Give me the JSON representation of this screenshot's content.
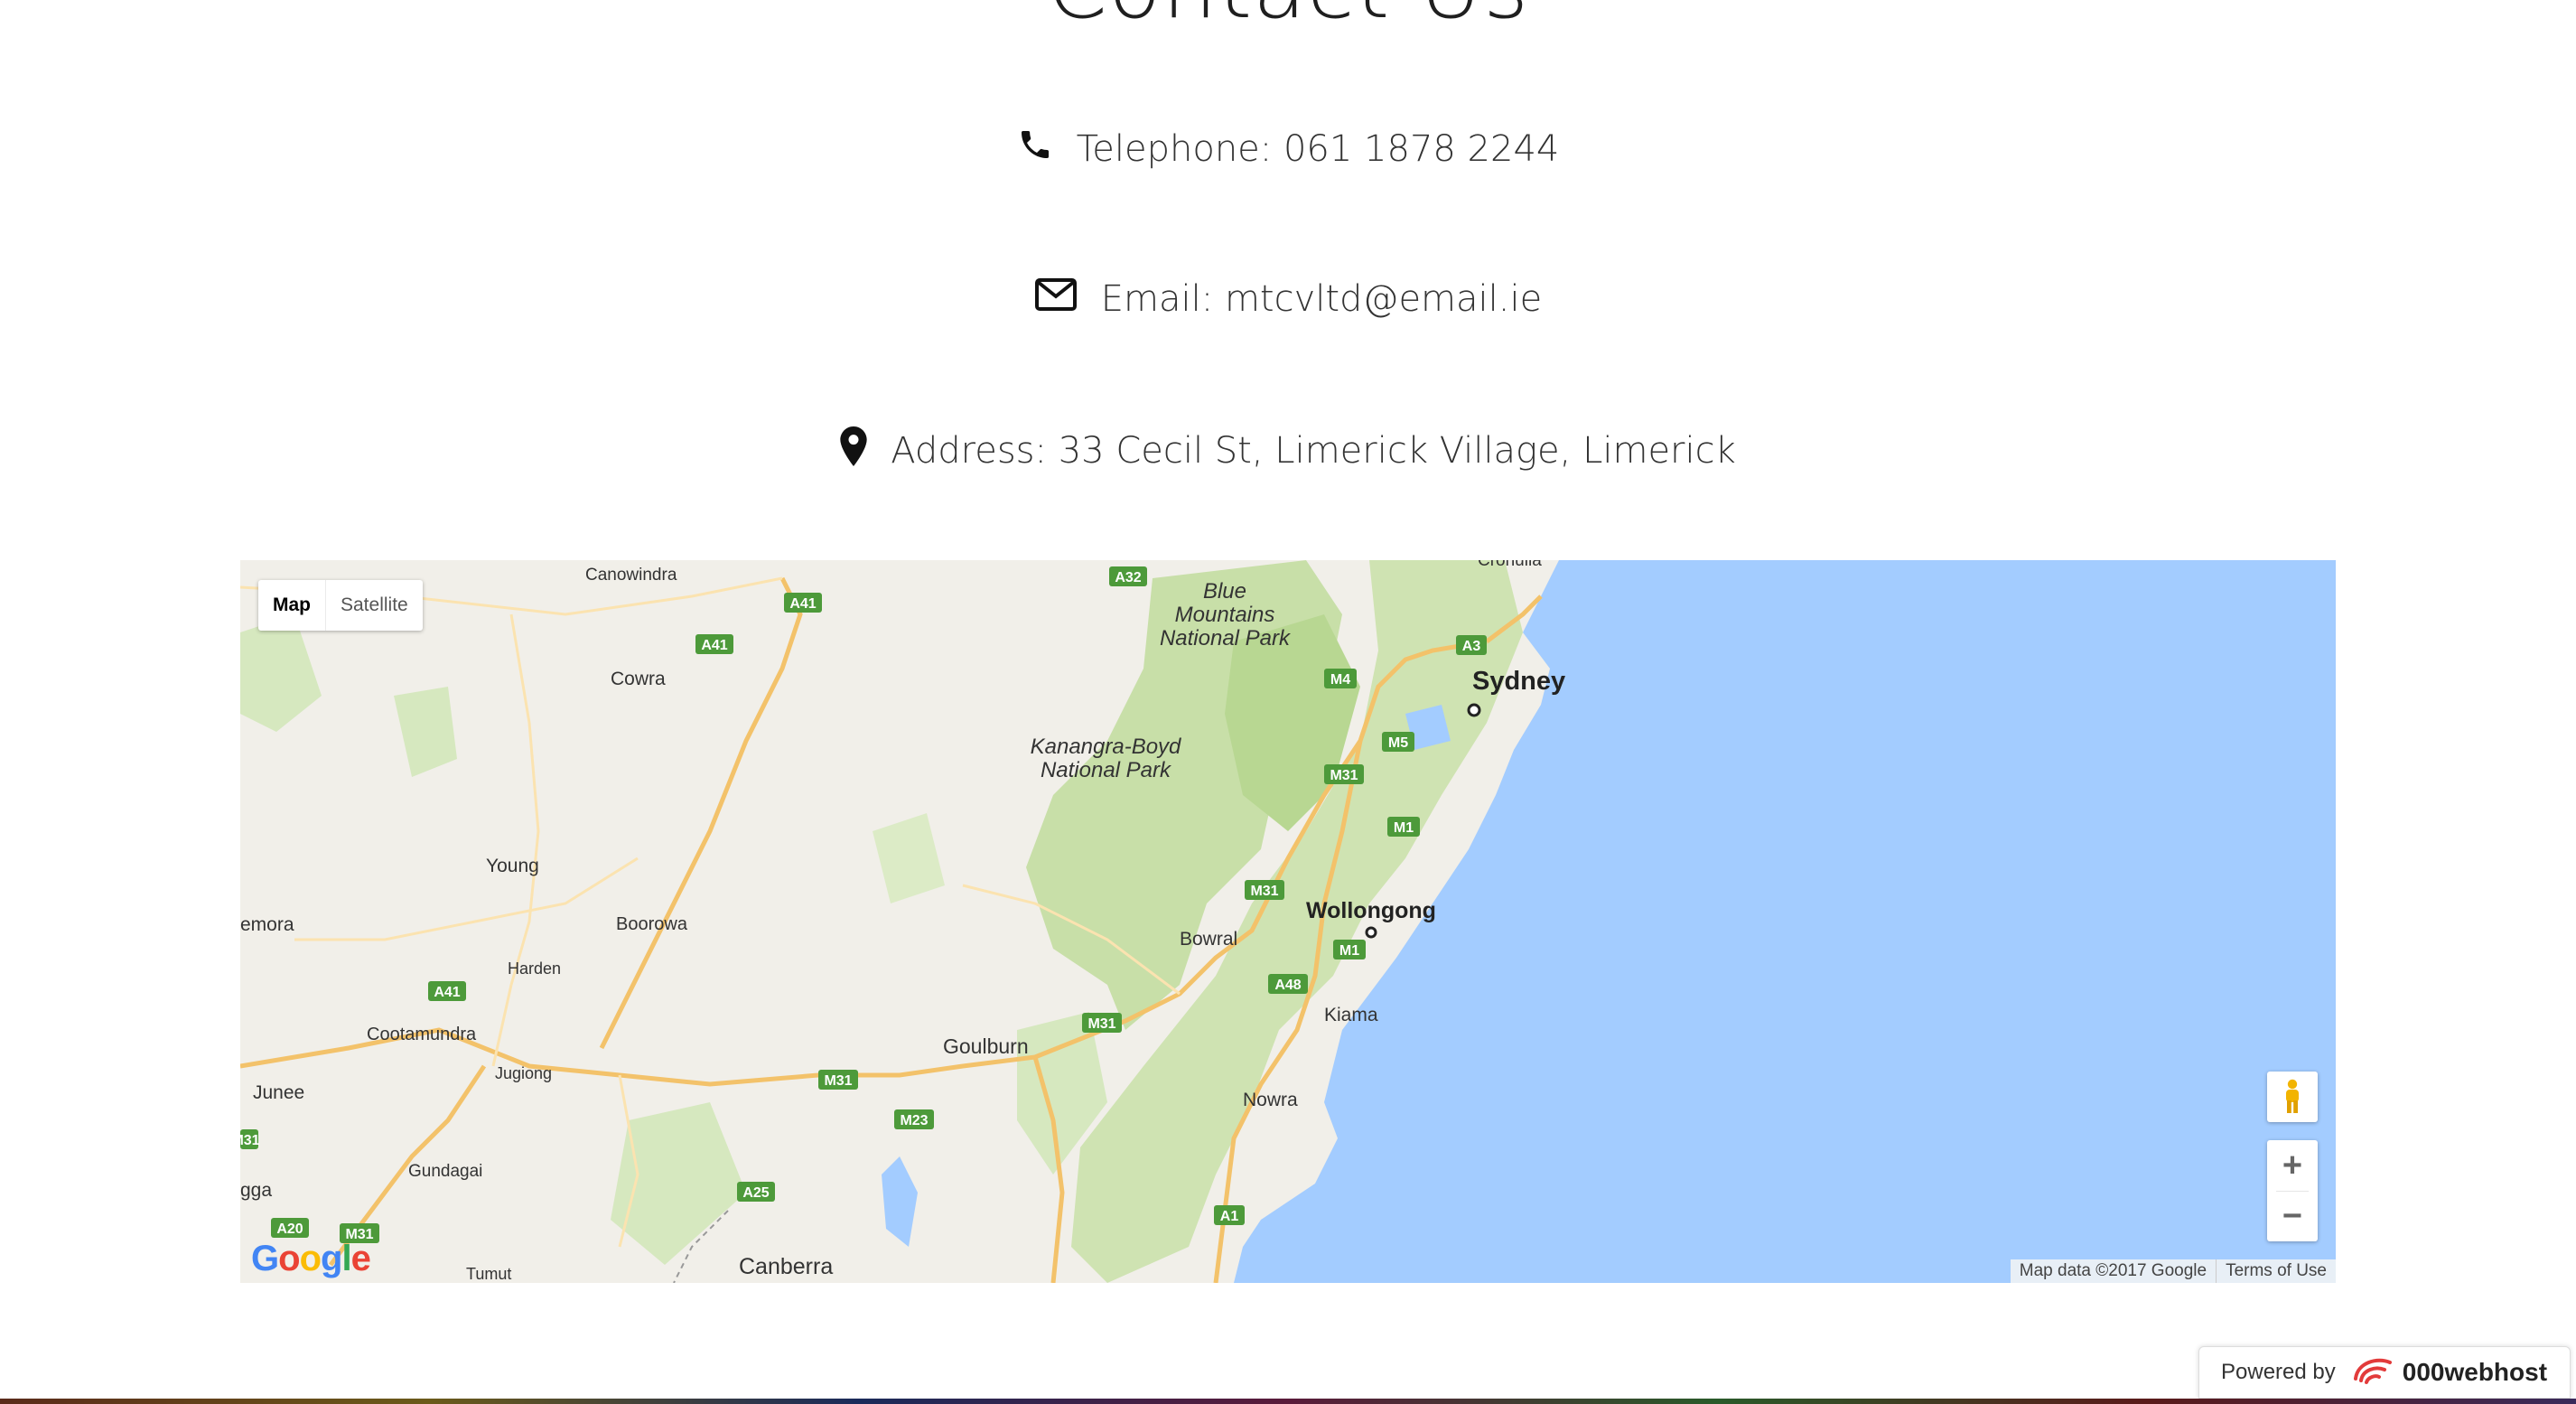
{
  "page": {
    "title": "Contact Us"
  },
  "contact": {
    "telephone": "Telephone: 061 1878 2244",
    "email": "Email: mtcvltd@email.ie",
    "address": "Address: 33 Cecil St, Limerick Village, Limerick"
  },
  "map": {
    "type_control": {
      "map": "Map",
      "satellite": "Satellite"
    },
    "zoom_in": "+",
    "zoom_out": "−",
    "attribution": "Map data ©2017 Google",
    "terms": "Terms of Use",
    "logo": "Google",
    "places": {
      "sydney": "Sydney",
      "wollongong": "Wollongong",
      "bowral": "Bowral",
      "kiama": "Kiama",
      "nowra": "Nowra",
      "goulburn": "Goulburn",
      "canberra": "Canberra",
      "cowra": "Cowra",
      "young": "Young",
      "boorowa": "Boorowa",
      "harden": "Harden",
      "cootamundra": "Cootamundra",
      "junee": "Junee",
      "jugiong": "Jugiong",
      "gundagai": "Gundagai",
      "tumut": "Tumut",
      "canowindra": "Canowindra",
      "temora": "emora",
      "wagga": "gga",
      "cronulla": "Cronulla"
    },
    "parks": {
      "blue_mountains": [
        "Blue",
        "Mountains",
        "National Park"
      ],
      "kanangra": [
        "Kanangra-Boyd",
        "National Park"
      ]
    },
    "shields": {
      "a32": "A32",
      "a41a": "A41",
      "a41b": "A41",
      "a41c": "A41",
      "a3": "A3",
      "m4": "M4",
      "m5": "M5",
      "m31a": "M31",
      "m31b": "M31",
      "m31c": "M31",
      "m31d": "M31",
      "m31e": "M31",
      "m1a": "M1",
      "m1b": "M1",
      "a48": "A48",
      "m23": "M23",
      "a25": "A25",
      "a1": "A1",
      "a20": "A20",
      "m31f": "M31"
    }
  },
  "footer": {
    "powered_by": "Powered by",
    "brand": "000webhost"
  }
}
